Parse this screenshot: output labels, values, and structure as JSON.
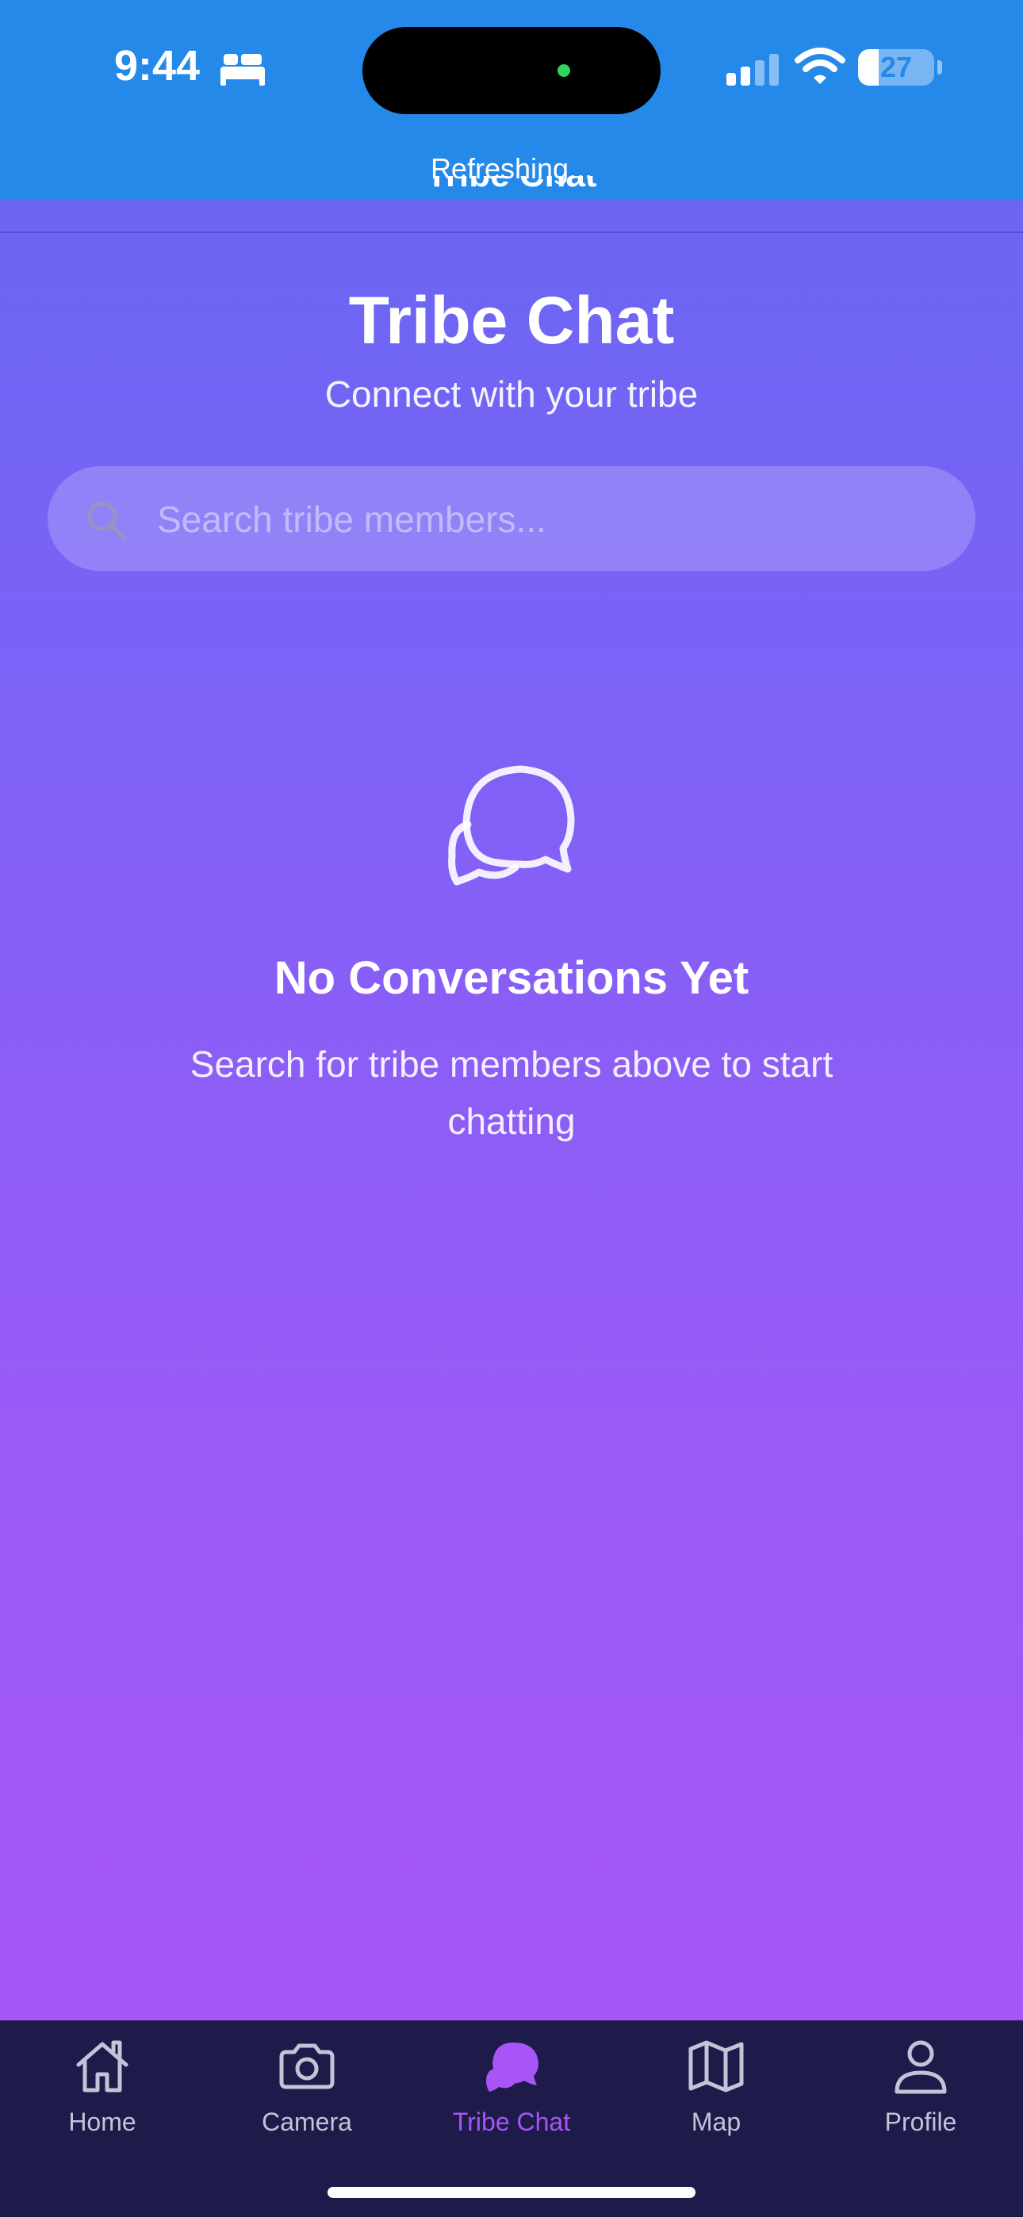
{
  "status_bar": {
    "time": "9:44",
    "battery_level": 27,
    "battery_label": "27",
    "focus_icon": "bed-icon",
    "signal_icon": "cellular-signal-icon",
    "wifi_icon": "wifi-icon"
  },
  "refresh": {
    "text": "Refreshing..."
  },
  "nav": {
    "title": "Tribe Chat"
  },
  "header": {
    "title": "Tribe Chat",
    "subtitle": "Connect with your tribe"
  },
  "search": {
    "placeholder": "Search tribe members...",
    "value": "",
    "icon": "search-icon"
  },
  "empty_state": {
    "icon": "chat-bubbles-icon",
    "title": "No Conversations Yet",
    "description": "Search for tribe members above to start chatting"
  },
  "tabs": [
    {
      "label": "Home",
      "icon": "home-icon",
      "active": false
    },
    {
      "label": "Camera",
      "icon": "camera-icon",
      "active": false
    },
    {
      "label": "Tribe Chat",
      "icon": "chat-icon",
      "active": true
    },
    {
      "label": "Map",
      "icon": "map-icon",
      "active": false
    },
    {
      "label": "Profile",
      "icon": "profile-icon",
      "active": false
    }
  ],
  "colors": {
    "status_bar_bg": "#2589ea",
    "gradient_top": "#6468f1",
    "gradient_bottom": "#a855f7",
    "tab_bar_bg": "#1e1b4b",
    "tab_active": "#a855f7",
    "tab_inactive": "#c4c3d8"
  }
}
